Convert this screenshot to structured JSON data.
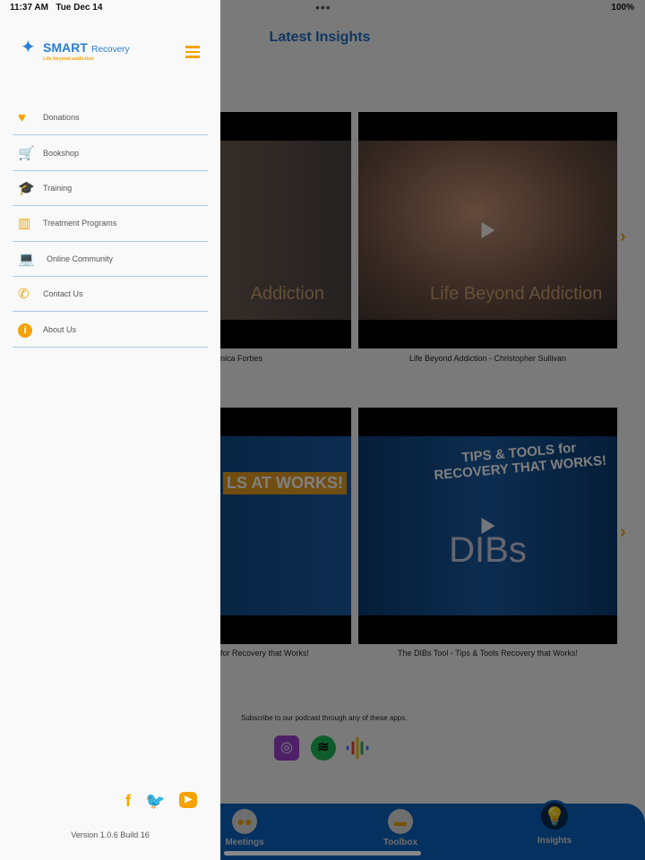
{
  "status_bar": {
    "time": "11:37 AM",
    "date": "Tue Dec 14",
    "battery": "100%"
  },
  "main": {
    "title": "Latest Insights",
    "videos": [
      {
        "caption": "nica Forbes",
        "overlay_text": "Addiction"
      },
      {
        "caption": "Life Beyond Addiction - Christopher Sullivan",
        "overlay_text": "Life Beyond Addiction"
      },
      {
        "caption": "for Recovery that Works!",
        "overlay_text": "LS AT WORKS!"
      },
      {
        "caption": "The DIBs Tool - Tips & Tools Recovery that Works!",
        "overlay_text": "TIPS & TOOLS for RECOVERY THAT WORKS!",
        "big_text": "DIBs"
      }
    ],
    "podcast_text": "Subscribe to our podcast through any of these apps.",
    "podcast_apps": [
      "apple-podcasts-icon",
      "spotify-icon",
      "google-podcasts-icon"
    ]
  },
  "tabbar": {
    "tabs": [
      {
        "label": "Meetings",
        "icon": "people-icon"
      },
      {
        "label": "Toolbox",
        "icon": "toolbox-icon"
      },
      {
        "label": "Insights",
        "icon": "lightbulb-icon",
        "active": true
      }
    ]
  },
  "drawer": {
    "logo": {
      "name": "SMART",
      "suffix": "Recovery",
      "tagline": "Life beyond addiction"
    },
    "menu": [
      {
        "label": "Donations",
        "icon": "heart-hand-icon"
      },
      {
        "label": "Bookshop",
        "icon": "cart-icon"
      },
      {
        "label": "Training",
        "icon": "graduation-cap-icon"
      },
      {
        "label": "Treatment Programs",
        "icon": "building-icon"
      },
      {
        "label": "Online Community",
        "icon": "laptop-user-icon"
      },
      {
        "label": "Contact Us",
        "icon": "phone-icon"
      },
      {
        "label": "About Us",
        "icon": "info-icon"
      }
    ],
    "social": [
      "facebook-icon",
      "twitter-icon",
      "youtube-icon"
    ],
    "version": "Version 1.0.6 Build 16"
  },
  "colors": {
    "accent": "#f5a300",
    "brand_blue": "#1f6fc4",
    "tabbar": "#0a62c0"
  }
}
